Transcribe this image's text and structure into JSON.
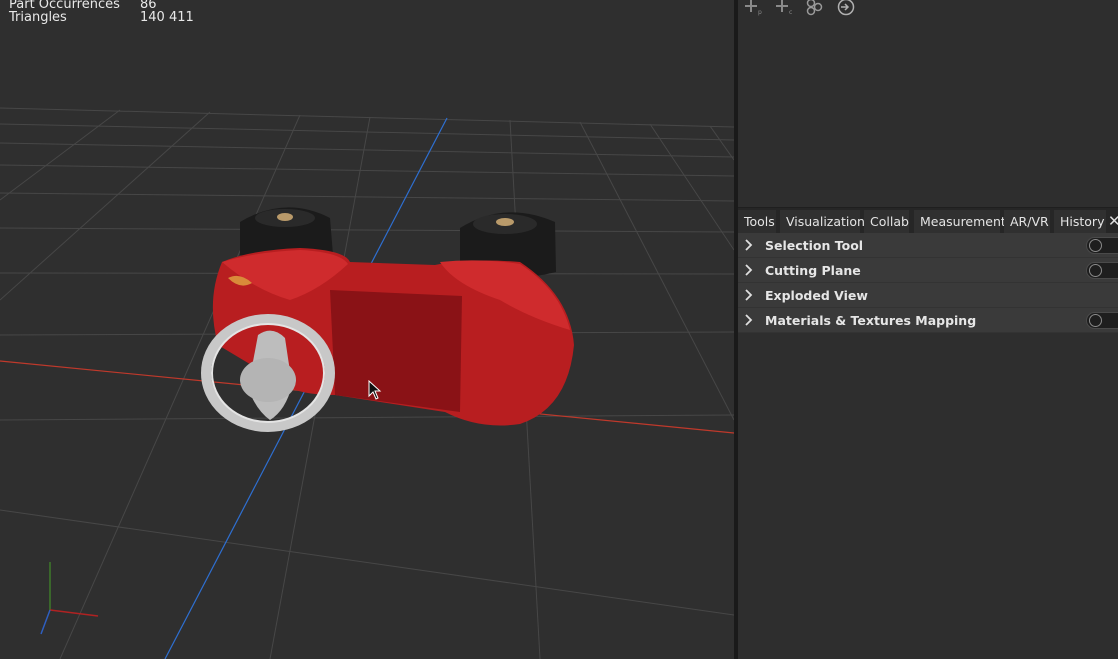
{
  "stats": {
    "part_occurrences_label": "Part Occurrences",
    "part_occurrences_value": "86",
    "triangles_label": "Triangles",
    "triangles_value": "140 411"
  },
  "toolbar": {
    "icons": [
      "add-part-icon",
      "add-component-icon",
      "group-icon",
      "import-icon"
    ]
  },
  "tabs": [
    {
      "label": "Tools",
      "active": true
    },
    {
      "label": "Visualization"
    },
    {
      "label": "Collab"
    },
    {
      "label": "Measurement"
    },
    {
      "label": "AR/VR"
    },
    {
      "label": "History"
    }
  ],
  "close_glyph": "✕",
  "tools": [
    {
      "label": "Selection Tool",
      "toggle": true,
      "on": false
    },
    {
      "label": "Cutting Plane",
      "toggle": true,
      "on": false
    },
    {
      "label": "Exploded View",
      "toggle": false
    },
    {
      "label": "Materials & Textures Mapping",
      "toggle": true,
      "on": false
    }
  ],
  "colors": {
    "car_body": "#b81e20",
    "tires": "#1b1b1b",
    "steering_wheel": "#c8c8c8",
    "x_axis": "#c0392b",
    "y_axis": "#2e6fd1",
    "grid": "#4a4a4a"
  }
}
